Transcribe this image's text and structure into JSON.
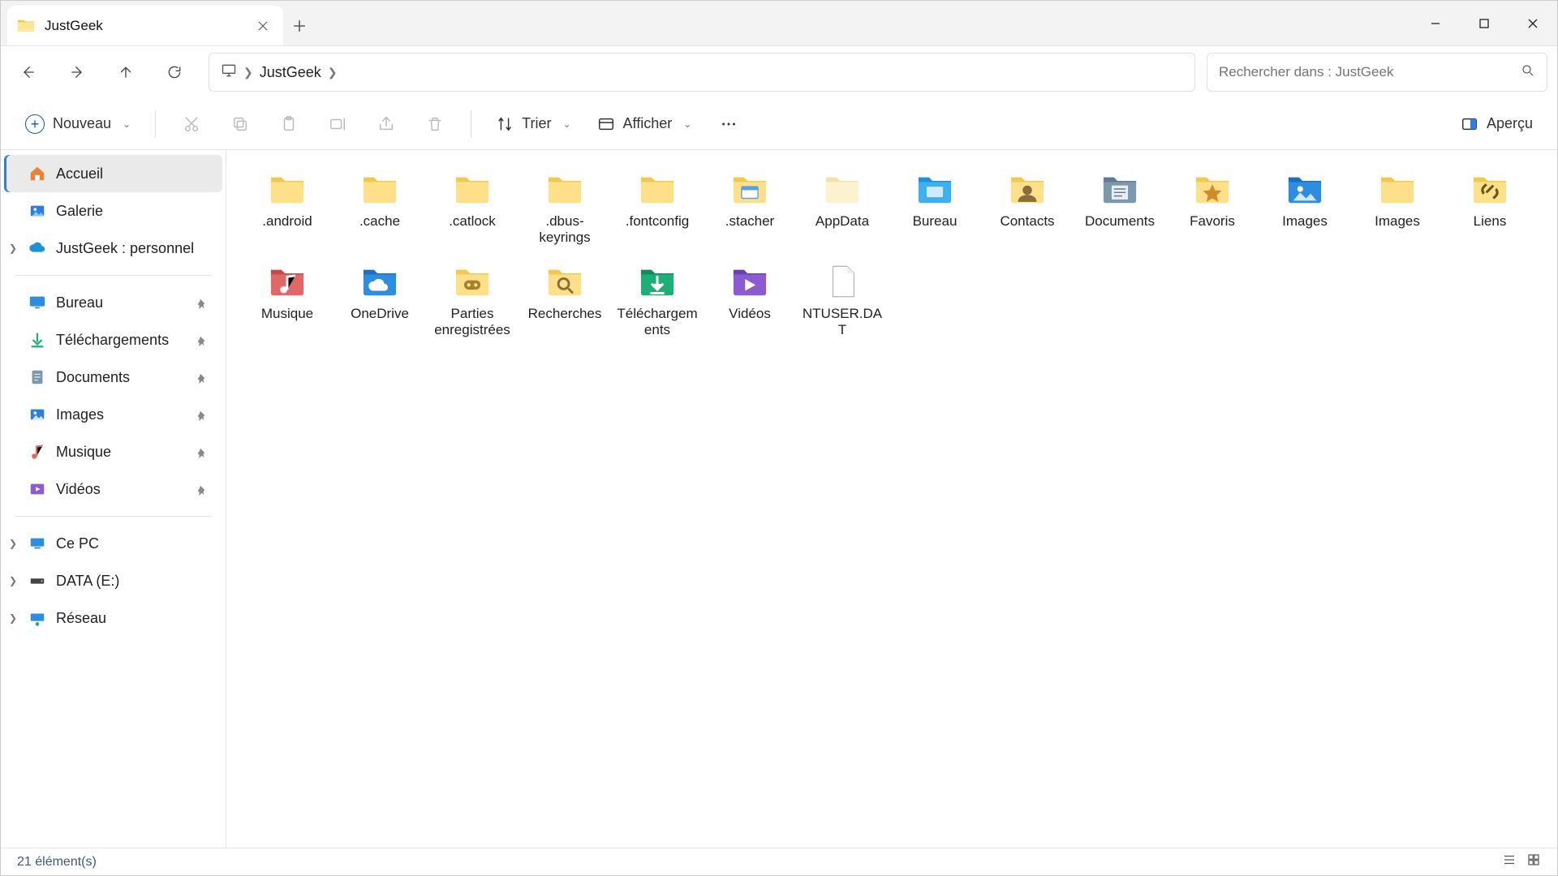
{
  "window": {
    "tab_title": "JustGeek",
    "minimize": "–",
    "maximize": "□",
    "close": "✕"
  },
  "address": {
    "location": "JustGeek",
    "search_placeholder": "Rechercher dans : JustGeek"
  },
  "toolbar": {
    "new_label": "Nouveau",
    "sort_label": "Trier",
    "view_label": "Afficher",
    "preview_label": "Aperçu"
  },
  "sidebar": {
    "home": "Accueil",
    "gallery": "Galerie",
    "personal": "JustGeek : personnel",
    "quick": [
      {
        "label": "Bureau",
        "icon": "desktop"
      },
      {
        "label": "Téléchargements",
        "icon": "downloads"
      },
      {
        "label": "Documents",
        "icon": "documents"
      },
      {
        "label": "Images",
        "icon": "images"
      },
      {
        "label": "Musique",
        "icon": "music"
      },
      {
        "label": "Vidéos",
        "icon": "videos"
      }
    ],
    "drives": [
      {
        "label": "Ce PC",
        "icon": "pc"
      },
      {
        "label": "DATA (E:)",
        "icon": "drive"
      },
      {
        "label": "Réseau",
        "icon": "network"
      }
    ]
  },
  "items": [
    {
      "label": ".android",
      "type": "folder"
    },
    {
      "label": ".cache",
      "type": "folder"
    },
    {
      "label": ".catlock",
      "type": "folder"
    },
    {
      "label": ".dbus-keyrings",
      "type": "folder"
    },
    {
      "label": ".fontconfig",
      "type": "folder"
    },
    {
      "label": ".stacher",
      "type": "folder-window"
    },
    {
      "label": "AppData",
      "type": "folder-faded"
    },
    {
      "label": "Bureau",
      "type": "desktop-blue"
    },
    {
      "label": "Contacts",
      "type": "contacts"
    },
    {
      "label": "Documents",
      "type": "documents-blue"
    },
    {
      "label": "Favoris",
      "type": "favorites"
    },
    {
      "label": "Images",
      "type": "images-blue"
    },
    {
      "label": "Images",
      "type": "folder"
    },
    {
      "label": "Liens",
      "type": "links"
    },
    {
      "label": "Musique",
      "type": "music-red"
    },
    {
      "label": "OneDrive",
      "type": "onedrive"
    },
    {
      "label": "Parties enregistrées",
      "type": "savedgames"
    },
    {
      "label": "Recherches",
      "type": "searches"
    },
    {
      "label": "Téléchargements",
      "type": "downloads-green"
    },
    {
      "label": "Vidéos",
      "type": "videos-purple"
    },
    {
      "label": "NTUSER.DAT",
      "type": "file"
    }
  ],
  "status": {
    "count_text": "21 élément(s)"
  }
}
